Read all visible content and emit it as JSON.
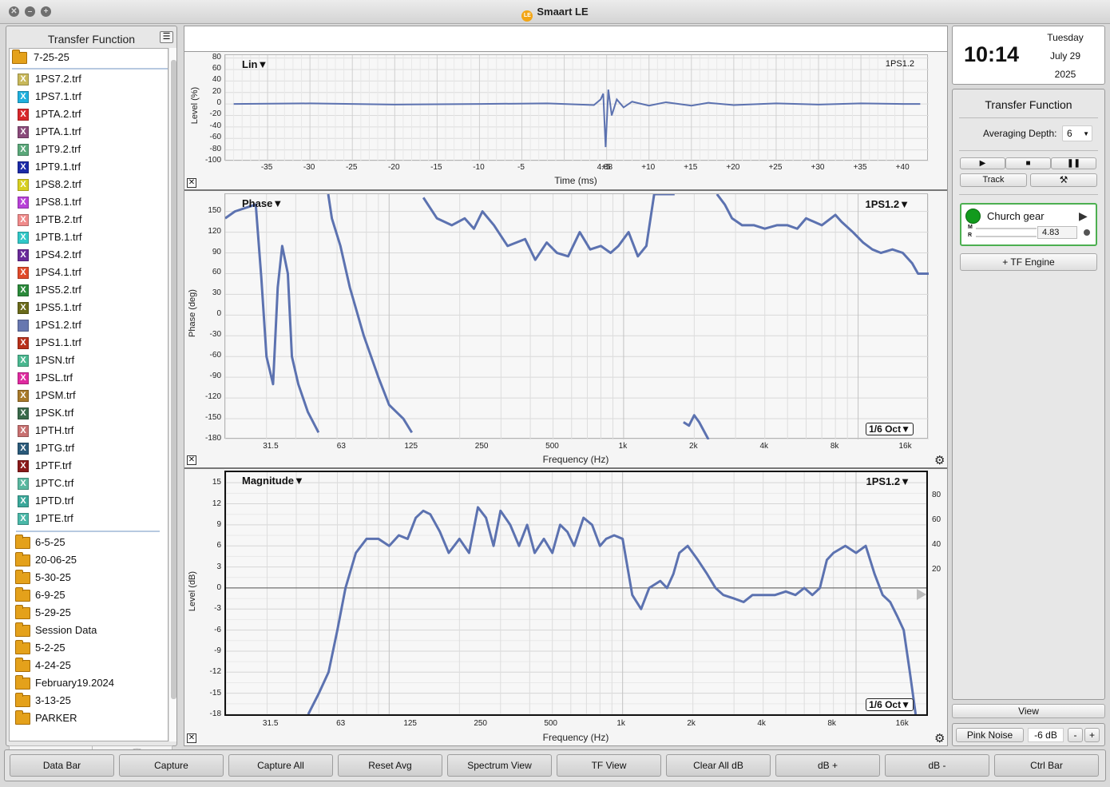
{
  "window": {
    "title": "Smaart LE",
    "logo_text": "LE"
  },
  "left_panel": {
    "title": "Transfer Function",
    "current_folder": "7-25-25",
    "files": [
      {
        "name": "1PS7.2.trf",
        "color": "#c8b85a",
        "icon": "x-file-icon"
      },
      {
        "name": "1PS7.1.trf",
        "color": "#1fb0de",
        "icon": "x-file-icon"
      },
      {
        "name": "1PTA.2.trf",
        "color": "#d8272b",
        "icon": "x-file-icon"
      },
      {
        "name": "1PTA.1.trf",
        "color": "#8a4a7a",
        "icon": "x-file-icon"
      },
      {
        "name": "1PT9.2.trf",
        "color": "#5aa87a",
        "icon": "x-file-icon"
      },
      {
        "name": "1PT9.1.trf",
        "color": "#1a2aa8",
        "icon": "x-file-icon"
      },
      {
        "name": "1PS8.2.trf",
        "color": "#d8d020",
        "icon": "x-file-icon"
      },
      {
        "name": "1PS8.1.trf",
        "color": "#b840d8",
        "icon": "x-file-icon"
      },
      {
        "name": "1PTB.2.trf",
        "color": "#f08a8a",
        "icon": "x-file-icon"
      },
      {
        "name": "1PTB.1.trf",
        "color": "#30c8c8",
        "icon": "x-file-icon"
      },
      {
        "name": "1PS4.2.trf",
        "color": "#6a2a9a",
        "icon": "x-file-icon"
      },
      {
        "name": "1PS4.1.trf",
        "color": "#e04a2a",
        "icon": "x-file-icon"
      },
      {
        "name": "1PS5.2.trf",
        "color": "#2a8a3a",
        "icon": "x-file-icon"
      },
      {
        "name": "1PS5.1.trf",
        "color": "#6a6a1a",
        "icon": "x-file-icon"
      },
      {
        "name": "1PS1.2.trf",
        "color": "#6878b0",
        "icon": "doc-file-icon"
      },
      {
        "name": "1PS1.1.trf",
        "color": "#b8301a",
        "icon": "x-file-icon"
      },
      {
        "name": "1PSN.trf",
        "color": "#4ab890",
        "icon": "x-file-icon"
      },
      {
        "name": "1PSL.trf",
        "color": "#e02aa0",
        "icon": "x-file-icon"
      },
      {
        "name": "1PSM.trf",
        "color": "#a87a2a",
        "icon": "x-file-icon"
      },
      {
        "name": "1PSK.trf",
        "color": "#3a6a4a",
        "icon": "x-file-icon"
      },
      {
        "name": "1PTH.trf",
        "color": "#c87070",
        "icon": "x-file-icon"
      },
      {
        "name": "1PTG.trf",
        "color": "#2a5a7a",
        "icon": "x-file-icon"
      },
      {
        "name": "1PTF.trf",
        "color": "#8a1a1a",
        "icon": "x-file-icon"
      },
      {
        "name": "1PTC.trf",
        "color": "#5ab8a0",
        "icon": "x-file-icon"
      },
      {
        "name": "1PTD.trf",
        "color": "#3aa89a",
        "icon": "x-file-icon"
      },
      {
        "name": "1PTE.trf",
        "color": "#4ab8a8",
        "icon": "x-file-icon"
      }
    ],
    "folders": [
      "6-5-25",
      "20-06-25",
      "5-30-25",
      "6-9-25",
      "5-29-25",
      "Session Data",
      "5-2-25",
      "4-24-25",
      "February19.2024",
      "3-13-25",
      "PARKER"
    ],
    "bottom_icons": [
      "info-icon",
      "trash-icon"
    ]
  },
  "impulse_plot": {
    "title": "Lin",
    "trace": "1PS1.2",
    "ylabel": "Level (%)",
    "xlabel": "Time (ms)",
    "yticks": [
      "80",
      "60",
      "40",
      "20",
      "0",
      "-20",
      "-40",
      "-60",
      "-80",
      "-100"
    ],
    "xticks": [
      "-35",
      "-30",
      "-25",
      "-20",
      "-15",
      "-10",
      "-5",
      "4.88",
      "+5",
      "+10",
      "+15",
      "+20",
      "+25",
      "+30",
      "+35",
      "+40"
    ],
    "color": "#5c72b0"
  },
  "phase_plot": {
    "title": "Phase",
    "trace": "1PS1.2",
    "ylabel": "Phase (deg)",
    "xlabel": "Frequency (Hz)",
    "smoothing": "1/6 Oct",
    "yticks": [
      "150",
      "120",
      "90",
      "60",
      "30",
      "0",
      "-30",
      "-60",
      "-90",
      "-120",
      "-150",
      "-180"
    ],
    "xticks": [
      "31.5",
      "63",
      "125",
      "250",
      "500",
      "1k",
      "2k",
      "4k",
      "8k",
      "16k"
    ]
  },
  "magnitude_plot": {
    "title": "Magnitude",
    "trace": "1PS1.2",
    "ylabel": "Level (dB)",
    "xlabel": "Frequency (Hz)",
    "smoothing": "1/6 Oct",
    "yticks": [
      "15",
      "12",
      "9",
      "6",
      "3",
      "0",
      "-3",
      "-6",
      "-9",
      "-12",
      "-15",
      "-18"
    ],
    "yticks_right": [
      "80",
      "60",
      "40",
      "20"
    ],
    "xticks": [
      "31.5",
      "63",
      "125",
      "250",
      "500",
      "1k",
      "2k",
      "4k",
      "8k",
      "16k"
    ]
  },
  "chart_data": [
    {
      "type": "line",
      "title": "Lin",
      "xlabel": "Time (ms)",
      "ylabel": "Level (%)",
      "xlim": [
        -40,
        43
      ],
      "ylim": [
        -100,
        85
      ],
      "series": [
        {
          "name": "1PS1.2",
          "x": [
            -39,
            -30,
            -20,
            -10,
            -2,
            3.5,
            4.3,
            4.6,
            4.88,
            5.2,
            5.6,
            6.2,
            7,
            8,
            10,
            12,
            15,
            17,
            20,
            25,
            30,
            35,
            40,
            42
          ],
          "y": [
            0,
            1,
            -1,
            0,
            1,
            -2,
            8,
            18,
            -75,
            25,
            -20,
            8,
            -6,
            4,
            -3,
            3,
            -3,
            2,
            -2,
            1,
            -1,
            1,
            0,
            0
          ]
        }
      ]
    },
    {
      "type": "line",
      "title": "Phase",
      "xlabel": "Frequency (Hz)",
      "ylabel": "Phase (deg)",
      "xscale": "log",
      "xlim": [
        20,
        20000
      ],
      "ylim": [
        -180,
        175
      ],
      "series": [
        {
          "name": "1PS1.2",
          "x": [
            20,
            22,
            27,
            28.5,
            30,
            32,
            33.5,
            35,
            37,
            38.5,
            41,
            45,
            50,
            55,
            57,
            62,
            68,
            78,
            90,
            100,
            115,
            125,
            140,
            160,
            185,
            210,
            230,
            250,
            280,
            320,
            380,
            420,
            470,
            520,
            580,
            650,
            720,
            800,
            880,
            950,
            1050,
            1150,
            1250,
            1350,
            1500,
            1650,
            1800,
            1900,
            2000,
            2100,
            2300,
            2500,
            2700,
            2900,
            3200,
            3600,
            4000,
            4500,
            5000,
            5500,
            6000,
            7000,
            8000,
            8500,
            9500,
            10500,
            11500,
            12500,
            14000,
            15500,
            17000,
            18000,
            20000
          ],
          "y": [
            140,
            150,
            160,
            55,
            -60,
            -100,
            40,
            100,
            60,
            -60,
            -100,
            -140,
            -170,
            175,
            140,
            100,
            40,
            -30,
            -90,
            -130,
            -150,
            -170,
            170,
            140,
            130,
            140,
            125,
            150,
            130,
            100,
            110,
            80,
            105,
            90,
            85,
            120,
            95,
            100,
            90,
            100,
            120,
            85,
            100,
            175,
            175,
            175,
            -155,
            -160,
            -145,
            -155,
            -180,
            175,
            160,
            140,
            130,
            130,
            125,
            130,
            130,
            125,
            140,
            130,
            145,
            135,
            120,
            105,
            95,
            90,
            95,
            90,
            75,
            60,
            60
          ]
        }
      ]
    },
    {
      "type": "line",
      "title": "Magnitude",
      "xlabel": "Frequency (Hz)",
      "ylabel": "Level (dB)",
      "xscale": "log",
      "xlim": [
        20,
        20000
      ],
      "ylim": [
        -18,
        16.5
      ],
      "series": [
        {
          "name": "1PS1.2",
          "x": [
            45,
            50,
            55,
            60,
            65,
            72,
            80,
            90,
            100,
            110,
            120,
            130,
            140,
            150,
            165,
            180,
            200,
            220,
            240,
            260,
            280,
            300,
            330,
            360,
            390,
            420,
            460,
            500,
            540,
            580,
            620,
            680,
            740,
            800,
            850,
            920,
            1000,
            1100,
            1200,
            1300,
            1450,
            1550,
            1650,
            1750,
            1900,
            2100,
            2300,
            2500,
            2700,
            3000,
            3300,
            3600,
            4000,
            4500,
            5000,
            5500,
            6000,
            6500,
            7000,
            7500,
            8000,
            9000,
            10000,
            11000,
            12000,
            13000,
            14000,
            15000,
            16000,
            17000,
            18000
          ],
          "y": [
            -18,
            -15,
            -12,
            -6,
            0,
            5,
            7,
            7,
            6,
            7.5,
            7,
            10,
            11,
            10.5,
            8,
            5,
            7,
            5,
            11.5,
            10,
            6,
            11,
            9,
            6,
            9,
            5,
            7,
            5,
            9,
            8,
            6,
            10,
            9,
            6,
            7,
            7.5,
            7,
            -1,
            -3,
            0,
            1,
            0,
            2,
            5,
            6,
            4,
            2,
            0,
            -1,
            -1.5,
            -2,
            -1,
            -1,
            -1,
            -0.5,
            -1,
            0,
            -1,
            0,
            4,
            5,
            6,
            5,
            6,
            2,
            -1,
            -2,
            -4,
            -6,
            -12,
            -18
          ]
        }
      ]
    }
  ],
  "clock": {
    "time": "10:14",
    "weekday": "Tuesday",
    "date": "July 29",
    "year": "2025"
  },
  "right_panel": {
    "title": "Transfer Function",
    "averaging_label": "Averaging Depth:",
    "averaging_value": "6",
    "track_label": "Track",
    "engine_name": "Church gear",
    "engine_delay": "4.83",
    "meter_m": "M",
    "meter_r": "R",
    "add_engine": "+ TF Engine",
    "view_label": "View",
    "pink_noise": "Pink Noise",
    "noise_level": "-6 dB",
    "minus": "-",
    "plus": "+"
  },
  "bottom_bar": [
    "Data Bar",
    "Capture",
    "Capture All",
    "Reset Avg",
    "Spectrum View",
    "TF View",
    "Clear All dB",
    "dB +",
    "dB -",
    "Ctrl Bar"
  ]
}
